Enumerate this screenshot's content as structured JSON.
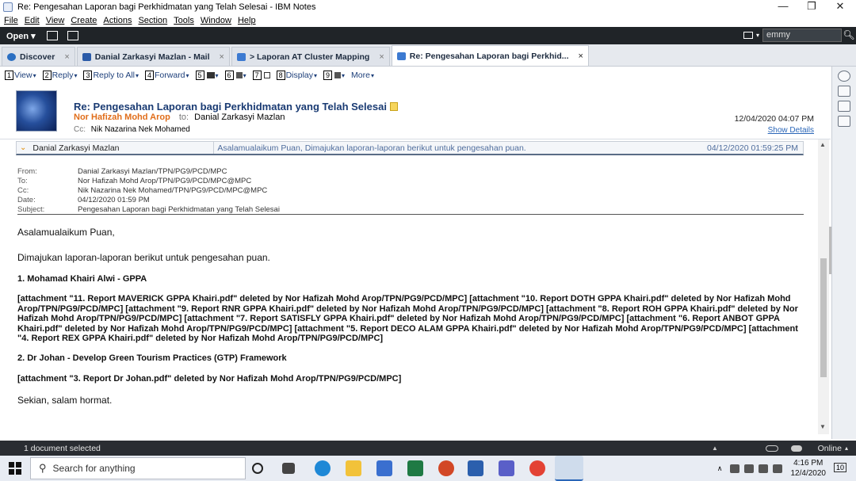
{
  "window": {
    "title": "Re: Pengesahan Laporan bagi Perkhidmatan yang Telah Selesai - IBM Notes",
    "minimize": "—",
    "maximize": "❐",
    "close": "✕"
  },
  "menu": [
    "File",
    "Edit",
    "View",
    "Create",
    "Actions",
    "Section",
    "Tools",
    "Window",
    "Help"
  ],
  "toolbar": {
    "open_label": "Open",
    "search_value": "emmy"
  },
  "tabs": [
    {
      "label": "Discover",
      "icon": "discover-icon",
      "color": "#2b6fc2"
    },
    {
      "label": "Danial Zarkasyi Mazlan - Mail",
      "icon": "mail-icon",
      "color": "#2a5aa8"
    },
    {
      "label": "> Laporan AT Cluster Mapping",
      "icon": "mail-doc-icon",
      "color": "#3c7ad1"
    },
    {
      "label": "Re: Pengesahan Laporan bagi Perkhid...",
      "icon": "mail-doc-icon",
      "color": "#3c7ad1"
    }
  ],
  "tab_close": "×",
  "actions": [
    {
      "num": "1",
      "label": "View"
    },
    {
      "num": "2",
      "label": "Reply"
    },
    {
      "num": "3",
      "label": "Reply to All"
    },
    {
      "num": "4",
      "label": "Forward"
    },
    {
      "num": "5",
      "label": ""
    },
    {
      "num": "6",
      "label": ""
    },
    {
      "num": "7",
      "label": ""
    },
    {
      "num": "8",
      "label": "Display"
    },
    {
      "num": "9",
      "label": ""
    },
    {
      "num": "",
      "label": "More"
    }
  ],
  "mail": {
    "subject": "Re: Pengesahan Laporan bagi Perkhidmatan yang Telah Selesai",
    "sender": "Nor Hafizah Mohd Arop",
    "to_label": "to:",
    "to": "Danial Zarkasyi Mazlan",
    "cc_label": "Cc:",
    "cc": "Nik Nazarina Nek Mohamed",
    "date": "12/04/2020 04:07 PM",
    "show_details": "Show Details"
  },
  "thread": {
    "name": "Danial Zarkasyi Mazlan",
    "snippet": "Asalamualaikum Puan, Dimajukan laporan-laporan berikut untuk pengesahan puan.",
    "date": "04/12/2020 01:59:25 PM"
  },
  "details": [
    {
      "label": "From:",
      "value": "Danial Zarkasyi Mazlan/TPN/PG9/PCD/MPC"
    },
    {
      "label": "To:",
      "value": "Nor Hafizah Mohd Arop/TPN/PG9/PCD/MPC@MPC"
    },
    {
      "label": "Cc:",
      "value": "Nik Nazarina Nek Mohamed/TPN/PG9/PCD/MPC@MPC"
    },
    {
      "label": "Date:",
      "value": "04/12/2020 01:59 PM"
    },
    {
      "label": "Subject:",
      "value": "Pengesahan Laporan bagi Perkhidmatan yang Telah Selesai"
    }
  ],
  "body": {
    "greeting": "Asalamualaikum Puan,",
    "intro": "Dimajukan laporan-laporan berikut untuk pengesahan puan.",
    "item1": "1. Mohamad Khairi Alwi - GPPA",
    "attach1": "[attachment \"11. Report MAVERICK GPPA Khairi.pdf\" deleted by Nor Hafizah Mohd Arop/TPN/PG9/PCD/MPC] [attachment \"10. Report DOTH GPPA Khairi.pdf\" deleted by Nor Hafizah Mohd Arop/TPN/PG9/PCD/MPC] [attachment \"9. Report RNR GPPA Khairi.pdf\" deleted by Nor Hafizah Mohd Arop/TPN/PG9/PCD/MPC] [attachment \"8. Report ROH GPPA Khairi.pdf\" deleted by Nor Hafizah Mohd Arop/TPN/PG9/PCD/MPC] [attachment \"7. Report SATISFLY GPPA Khairi.pdf\" deleted by Nor Hafizah Mohd Arop/TPN/PG9/PCD/MPC] [attachment \"6. Report ANBOT GPPA Khairi.pdf\" deleted by Nor Hafizah Mohd Arop/TPN/PG9/PCD/MPC] [attachment \"5. Report DECO ALAM GPPA Khairi.pdf\" deleted by Nor Hafizah Mohd Arop/TPN/PG9/PCD/MPC] [attachment \"4. Report REX GPPA Khairi.pdf\" deleted by Nor Hafizah Mohd Arop/TPN/PG9/PCD/MPC]",
    "item2": "2. Dr Johan - Develop Green Tourism Practices (GTP) Framework",
    "attach2": "[attachment \"3. Report Dr Johan.pdf\" deleted by Nor Hafizah Mohd Arop/TPN/PG9/PCD/MPC]",
    "closing": "Sekian, salam hormat."
  },
  "status": {
    "left": "1 document selected",
    "right": "Online"
  },
  "taskbar": {
    "search_placeholder": "Search for anything",
    "time": "4:16 PM",
    "date": "12/4/2020",
    "notifications": "10"
  }
}
